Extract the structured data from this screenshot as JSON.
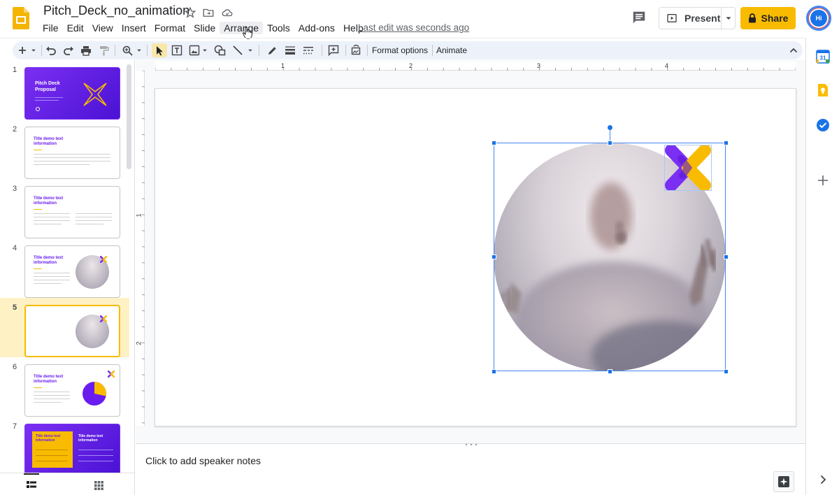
{
  "title_bar": {
    "doc_title": "Pitch_Deck_no_animation",
    "last_edit": "Last edit was seconds ago",
    "present_label": "Present",
    "share_label": "Share",
    "avatar_initials": "Hi"
  },
  "menu": [
    "File",
    "Edit",
    "View",
    "Insert",
    "Format",
    "Slide",
    "Arrange",
    "Tools",
    "Add-ons",
    "Help"
  ],
  "toolbar": {
    "format_options_label": "Format options",
    "animate_label": "Animate"
  },
  "ruler": {
    "horizontal": [
      "1",
      "2",
      "3",
      "4"
    ],
    "vertical": [
      "1",
      "2"
    ]
  },
  "slides": [
    {
      "number": "1",
      "title": "Pitch Deck Proposal",
      "style": "purple-cover"
    },
    {
      "number": "2",
      "title": "Title demo text information",
      "style": "text"
    },
    {
      "number": "3",
      "title": "Title demo text information",
      "style": "two-column"
    },
    {
      "number": "4",
      "title": "Title demo text information",
      "style": "text-image"
    },
    {
      "number": "5",
      "title": "",
      "style": "image-only",
      "selected": true
    },
    {
      "number": "6",
      "title": "Title demo text information",
      "style": "text-pie"
    },
    {
      "number": "7",
      "title": "Title demo text information",
      "style": "purple-two-box"
    }
  ],
  "notes": {
    "placeholder": "Click to add speaker notes"
  },
  "colors": {
    "accent_yellow": "#f9bb00",
    "accent_purple": "#6a1cf0",
    "selection_blue": "#1a73e8"
  }
}
